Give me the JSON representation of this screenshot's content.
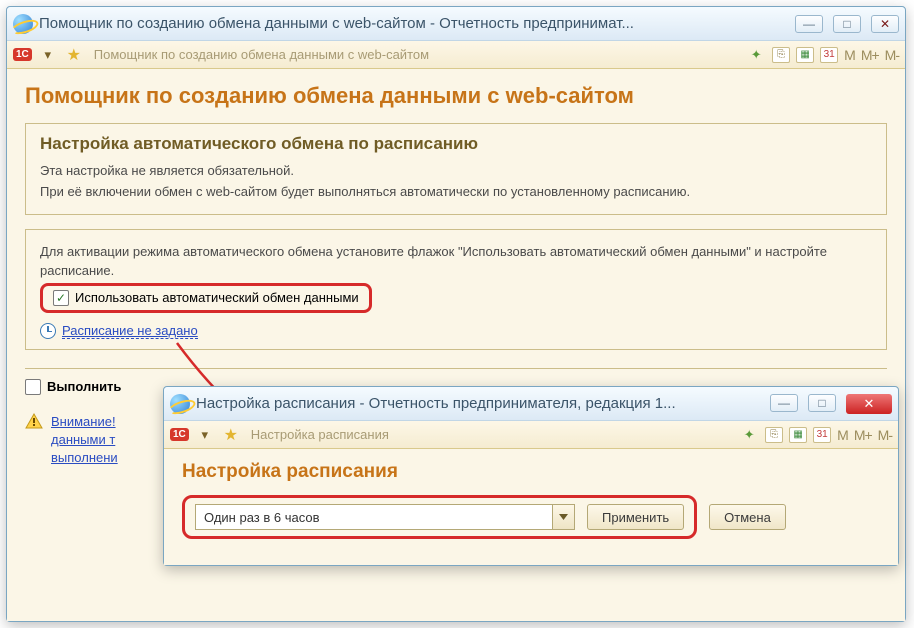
{
  "main_window": {
    "title": "Помощник по созданию обмена данными с web-сайтом - Отчетность предпринимат...",
    "toolbar_path": "Помощник по созданию обмена данными с web-сайтом",
    "m_labels": {
      "m": "M",
      "m_plus": "M+",
      "m_minus": "M-"
    }
  },
  "page": {
    "heading": "Помощник по созданию обмена данными с web-сайтом",
    "section_title": "Настройка автоматического обмена по расписанию",
    "intro1": "Эта настройка не является обязательной.",
    "intro2": "При её включении обмен с web-сайтом будет выполняться автоматически по установленному расписанию.",
    "activation_text": "Для активации режима автоматического обмена установите флажок \"Использовать автоматический обмен данными\" и настройте расписание.",
    "checkbox_label": "Использовать автоматический обмен данными",
    "schedule_link": "Расписание не задано",
    "execute_checkbox": "Выполнить",
    "warn_line1": "Внимание!",
    "warn_line2": "данными т",
    "warn_line3": "выполнени"
  },
  "sec_window": {
    "title": "Настройка расписания - Отчетность предпринимателя, редакция 1...",
    "toolbar_path": "Настройка расписания",
    "heading": "Настройка расписания",
    "combo_value": "Один раз в 6 часов",
    "apply_label": "Применить",
    "cancel_label": "Отмена",
    "m_labels": {
      "m": "M",
      "m_plus": "M+",
      "m_minus": "M-"
    }
  },
  "icons": {
    "minimize": "—",
    "maximize": "□",
    "close": "✕",
    "check": "✓",
    "cal_day": "31"
  }
}
